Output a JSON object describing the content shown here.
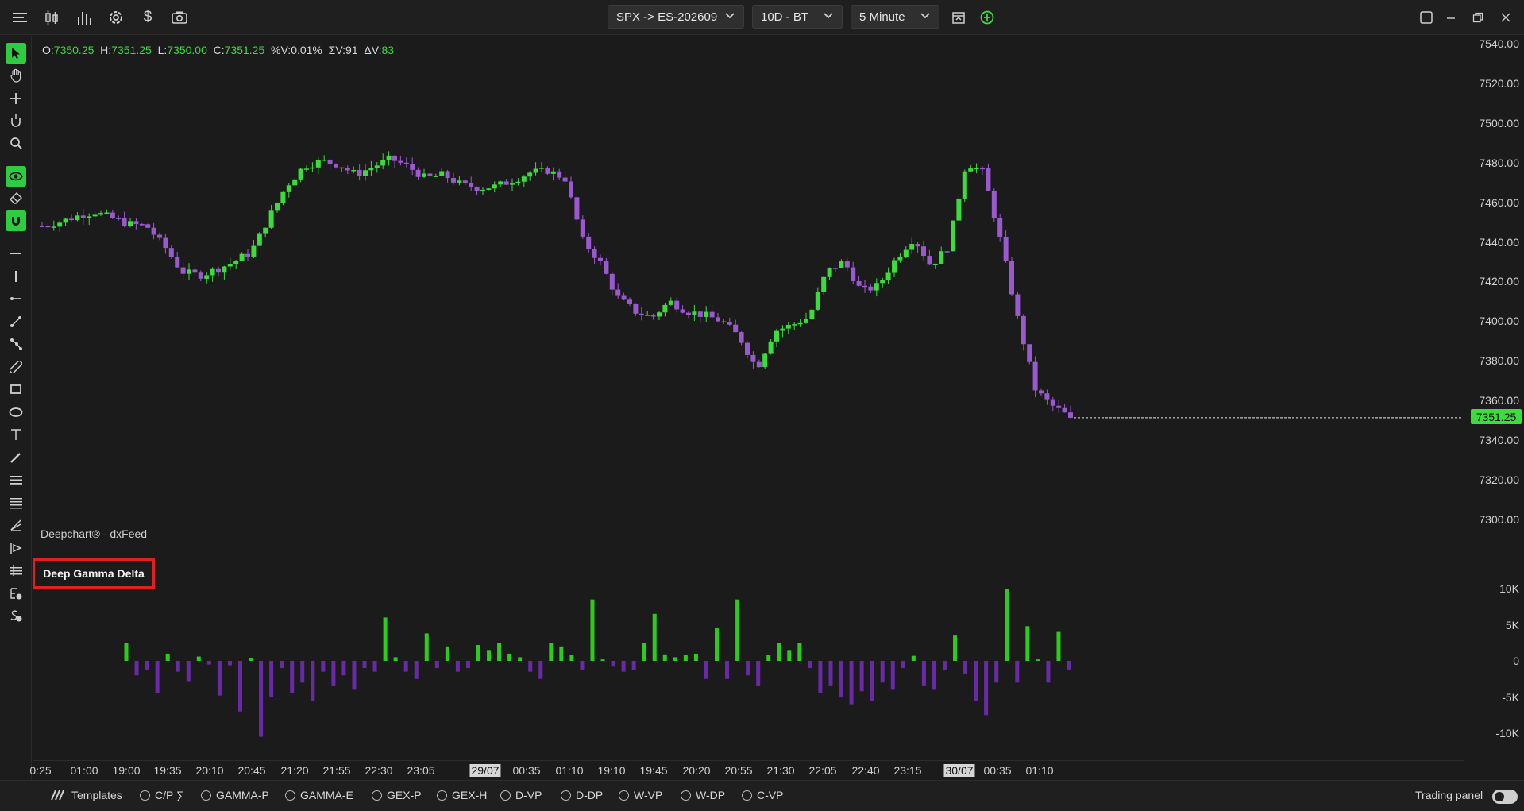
{
  "toolbar": {
    "symbol": "SPX -> ES-202609",
    "range": "10D - BT",
    "timeframe": "5 Minute",
    "icons": [
      "menu-icon",
      "candlestick-icon",
      "bar-chart-icon",
      "settings-icon",
      "dollar-icon",
      "camera-icon",
      "calendar-icon",
      "add-icon",
      "maximize-icon",
      "minimize-icon",
      "restore-icon",
      "close-icon"
    ]
  },
  "ohlc": {
    "o_label": "O:",
    "o": "7350.25",
    "h_label": "H:",
    "h": "7351.25",
    "l_label": "L:",
    "l": "7350.00",
    "c_label": "C:",
    "c": "7351.25",
    "pv_label": "%V:",
    "pv": "0.01%",
    "sv_label": "ΣV:",
    "sv": "91",
    "dv_label": "ΔV:",
    "dv": "83"
  },
  "watermark": "Deepchart® - dxFeed",
  "last_price": "7351.25",
  "price_axis": {
    "labels": [
      "7540.00",
      "7520.00",
      "7500.00",
      "7480.00",
      "7460.00",
      "7440.00",
      "7420.00",
      "7400.00",
      "7380.00",
      "7360.00",
      "7340.00",
      "7320.00",
      "7300.00"
    ]
  },
  "indicator": {
    "label": "Deep Gamma Delta",
    "axis_labels": [
      "10K",
      "5K",
      "0",
      "-5K",
      "-10K"
    ]
  },
  "time_axis": {
    "labels": [
      {
        "text": "0:25",
        "hl": false
      },
      {
        "text": "01:00",
        "hl": false
      },
      {
        "text": "19:00",
        "hl": false
      },
      {
        "text": "19:35",
        "hl": false
      },
      {
        "text": "20:10",
        "hl": false
      },
      {
        "text": "20:45",
        "hl": false
      },
      {
        "text": "21:20",
        "hl": false
      },
      {
        "text": "21:55",
        "hl": false
      },
      {
        "text": "22:30",
        "hl": false
      },
      {
        "text": "23:05",
        "hl": false
      },
      {
        "text": "29/07",
        "hl": true
      },
      {
        "text": "00:35",
        "hl": false
      },
      {
        "text": "01:10",
        "hl": false
      },
      {
        "text": "19:10",
        "hl": false
      },
      {
        "text": "19:45",
        "hl": false
      },
      {
        "text": "20:20",
        "hl": false
      },
      {
        "text": "20:55",
        "hl": false
      },
      {
        "text": "21:30",
        "hl": false
      },
      {
        "text": "22:05",
        "hl": false
      },
      {
        "text": "22:40",
        "hl": false
      },
      {
        "text": "23:15",
        "hl": false
      },
      {
        "text": "30/07",
        "hl": true
      },
      {
        "text": "00:35",
        "hl": false
      },
      {
        "text": "01:10",
        "hl": false
      }
    ]
  },
  "bottom": {
    "templates": "Templates",
    "items": [
      "C/P ∑",
      "GAMMA-P",
      "GAMMA-E",
      "GEX-P",
      "GEX-H",
      "D-VP",
      "D-DP",
      "W-VP",
      "W-DP",
      "C-VP"
    ],
    "trading_panel": "Trading panel"
  },
  "colors": {
    "up": "#3ddc3d",
    "down": "#9b59d0",
    "delta_up": "#2ecc1a",
    "delta_down": "#6a2aa8",
    "accent": "#2ecc40",
    "highlight": "#e0201e"
  },
  "chart_data": [
    {
      "type": "candlestick",
      "title": "",
      "ylim": [
        7290,
        7545
      ],
      "y_ticks": [
        7540,
        7520,
        7500,
        7480,
        7460,
        7440,
        7420,
        7400,
        7380,
        7360,
        7340,
        7320,
        7300
      ],
      "close_path": [
        7448,
        7450,
        7453,
        7455,
        7452,
        7449,
        7448,
        7438,
        7425,
        7423,
        7426,
        7430,
        7435,
        7452,
        7468,
        7478,
        7481,
        7479,
        7474,
        7478,
        7482,
        7478,
        7472,
        7474,
        7469,
        7467,
        7468,
        7471,
        7475,
        7476,
        7472,
        7441,
        7430,
        7412,
        7405,
        7402,
        7410,
        7405,
        7403,
        7400,
        7392,
        7376,
        7395,
        7398,
        7402,
        7425,
        7430,
        7415,
        7418,
        7432,
        7442,
        7428,
        7438,
        7480,
        7475,
        7440,
        7400,
        7365,
        7357,
        7351.25
      ],
      "last": 7351.25
    },
    {
      "type": "bar",
      "title": "Deep Gamma Delta",
      "ylim": [
        -10000,
        10000
      ],
      "y_ticks": [
        10000,
        5000,
        0,
        -5000,
        -10000
      ],
      "values": [
        2500,
        -2000,
        -1200,
        -4500,
        1000,
        -1500,
        -2800,
        600,
        -500,
        -4800,
        -600,
        -7000,
        400,
        -10500,
        -5000,
        -1000,
        -4500,
        -3000,
        -5500,
        -1500,
        -3500,
        -2000,
        -4000,
        -1000,
        -1500,
        6000,
        500,
        -1500,
        -2500,
        3800,
        -1000,
        2000,
        -1500,
        -1000,
        2200,
        1500,
        2500,
        1000,
        500,
        -1500,
        -2500,
        2500,
        2000,
        800,
        -1200,
        8500,
        200,
        -800,
        -1500,
        -1300,
        2500,
        6500,
        900,
        500,
        800,
        1000,
        -2500,
        4500,
        -2500,
        8500,
        -2000,
        -3500,
        800,
        2500,
        1500,
        2500,
        -1000,
        -4500,
        -3500,
        -5000,
        -6000,
        -4200,
        -5500,
        -3000,
        -4000,
        -1000,
        700,
        -3500,
        -4000,
        -1200,
        3500,
        -1800,
        -5500,
        -7500,
        -3000,
        10000,
        -3000,
        4800,
        200,
        -3000,
        4000,
        -1200
      ]
    }
  ]
}
